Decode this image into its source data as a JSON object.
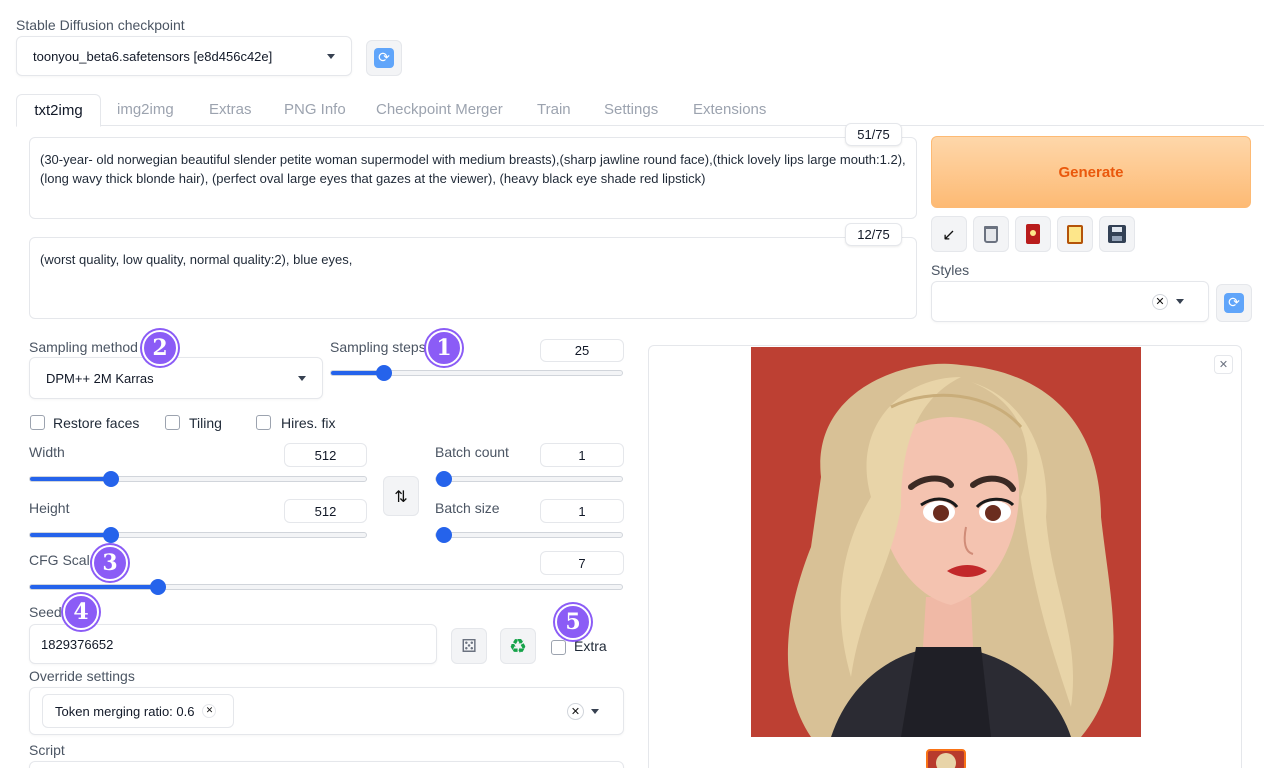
{
  "checkpoint": {
    "label": "Stable Diffusion checkpoint",
    "value": "toonyou_beta6.safetensors [e8d456c42e]",
    "refresh_icon": "refresh-icon"
  },
  "tabs": [
    {
      "label": "txt2img",
      "active": true
    },
    {
      "label": "img2img"
    },
    {
      "label": "Extras"
    },
    {
      "label": "PNG Info"
    },
    {
      "label": "Checkpoint Merger"
    },
    {
      "label": "Train"
    },
    {
      "label": "Settings"
    },
    {
      "label": "Extensions"
    }
  ],
  "prompt": {
    "text": "(30-year- old norwegian beautiful slender petite woman supermodel with medium breasts),(sharp jawline round face),(thick lovely lips large mouth:1.2),(long wavy thick blonde hair), (perfect oval large eyes that gazes at the viewer), (heavy black eye shade red lipstick)",
    "counter": "51/75"
  },
  "negative_prompt": {
    "text": "(worst quality, low quality, normal quality:2), blue eyes,",
    "counter": "12/75"
  },
  "generate": {
    "label": "Generate",
    "color": "#ea580c"
  },
  "tools": [
    "arrow-icon",
    "trash-icon",
    "red-card-icon",
    "clipboard-icon",
    "save-icon"
  ],
  "styles": {
    "label": "Styles",
    "value": ""
  },
  "sampling": {
    "method_label": "Sampling method",
    "method_value": "DPM++ 2M Karras",
    "steps_label": "Sampling steps",
    "steps_value": "25",
    "steps_fraction": 0.18
  },
  "checkboxes": {
    "restore_faces": "Restore faces",
    "tiling": "Tiling",
    "hires_fix": "Hires. fix"
  },
  "dims": {
    "width_label": "Width",
    "width_value": "512",
    "width_fraction": 0.24,
    "height_label": "Height",
    "height_value": "512",
    "height_fraction": 0.24,
    "batch_count_label": "Batch count",
    "batch_count_value": "1",
    "batch_size_label": "Batch size",
    "batch_size_value": "1"
  },
  "cfg": {
    "label": "CFG Scale",
    "value": "7",
    "fraction": 0.2
  },
  "seed": {
    "label": "Seed",
    "value": "1829376652",
    "extra_label": "Extra"
  },
  "override": {
    "label": "Override settings",
    "token": "Token merging ratio: 0.6"
  },
  "script": {
    "label": "Script"
  },
  "annotations": [
    "1",
    "2",
    "3",
    "4",
    "5"
  ],
  "accent": "#2563eb",
  "badge_color": "#8b5cf6"
}
